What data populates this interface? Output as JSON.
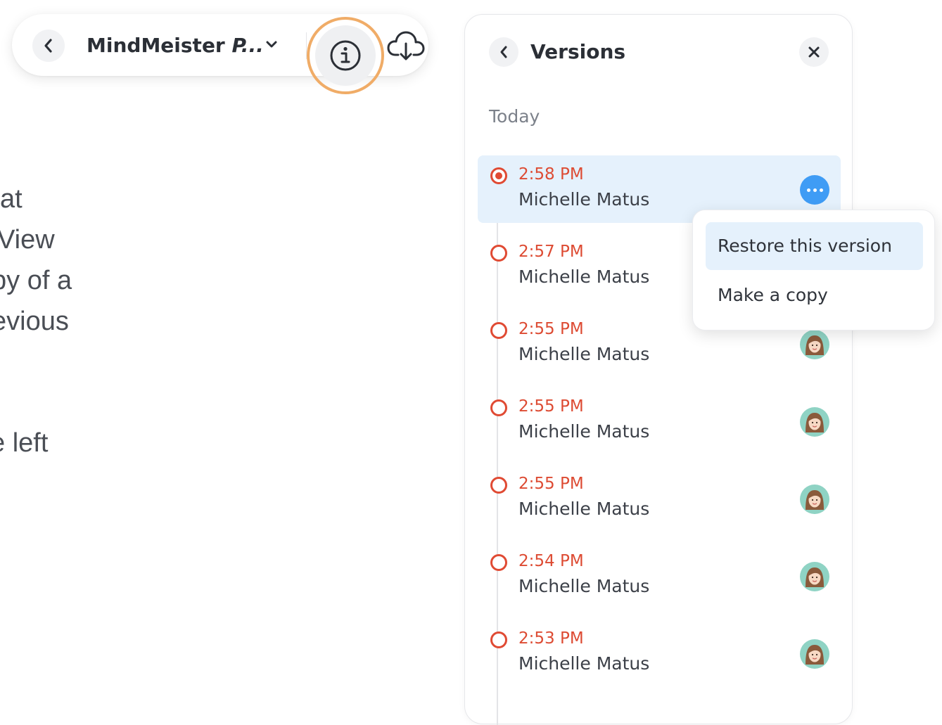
{
  "toolbar": {
    "map_title_plain": "MindMeister ",
    "map_title_italic": "P...",
    "back_icon": "chevron-left-icon",
    "caret_icon": "chevron-down-icon",
    "info_icon": "info-icon",
    "cloud_icon": "cloud-download-icon",
    "highlight_color": "#f0ac67"
  },
  "background_text": [
    "at",
    "View",
    "py of a",
    "evious",
    "e left"
  ],
  "versions_panel": {
    "title": "Versions",
    "section_label": "Today",
    "accent_color": "#dd4b33",
    "versions": [
      {
        "time": "2:58 PM",
        "author": "Michelle Matus",
        "active": true
      },
      {
        "time": "2:57 PM",
        "author": "Michelle Matus",
        "active": false
      },
      {
        "time": "2:55 PM",
        "author": "Michelle Matus",
        "active": false
      },
      {
        "time": "2:55 PM",
        "author": "Michelle Matus",
        "active": false
      },
      {
        "time": "2:55 PM",
        "author": "Michelle Matus",
        "active": false
      },
      {
        "time": "2:54 PM",
        "author": "Michelle Matus",
        "active": false
      },
      {
        "time": "2:53 PM",
        "author": "Michelle Matus",
        "active": false
      }
    ]
  },
  "context_menu": {
    "items": [
      {
        "label": "Restore this version"
      },
      {
        "label": "Make a copy"
      }
    ]
  }
}
